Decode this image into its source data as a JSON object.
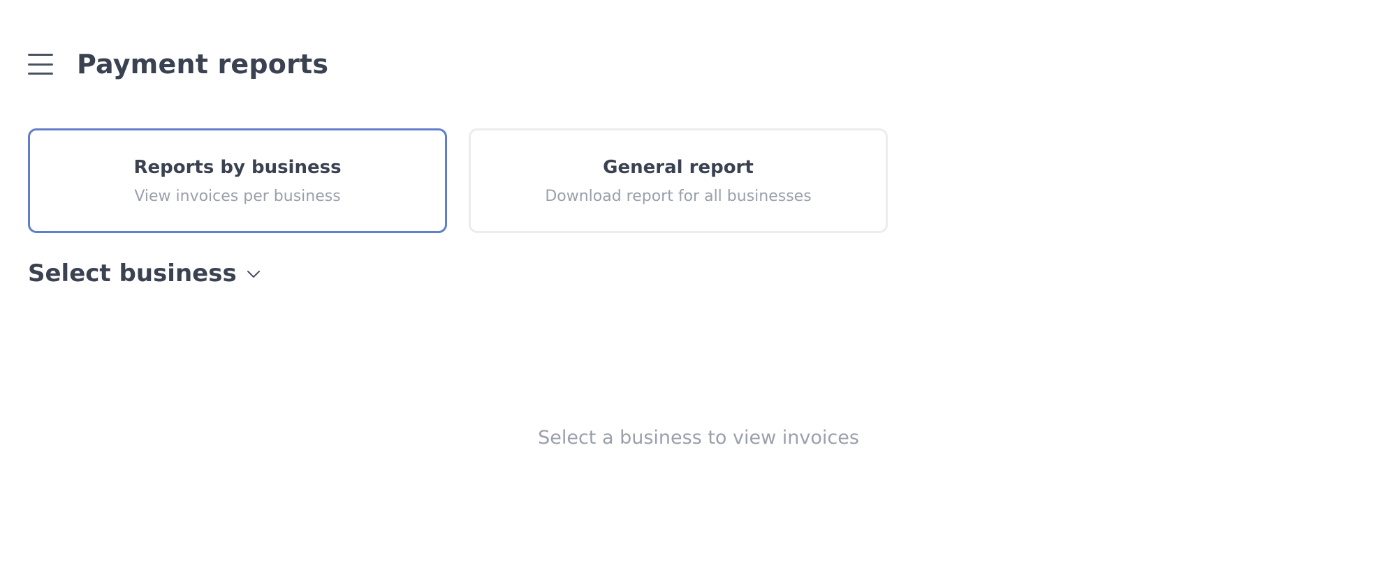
{
  "header": {
    "menu_icon": "hamburger-menu-icon",
    "title": "Payment reports"
  },
  "cards": [
    {
      "title": "Reports by business",
      "subtitle": "View invoices per business",
      "selected": true
    },
    {
      "title": "General report",
      "subtitle": "Download report for all businesses",
      "selected": false
    }
  ],
  "select_business": {
    "label": "Select business",
    "icon": "chevron-down-icon"
  },
  "empty_state": {
    "message": "Select a business to view invoices"
  },
  "colors": {
    "accent": "#5f7ecb",
    "text_primary": "#3a4150",
    "text_muted": "#9a9fab",
    "card_border": "#ececef"
  }
}
